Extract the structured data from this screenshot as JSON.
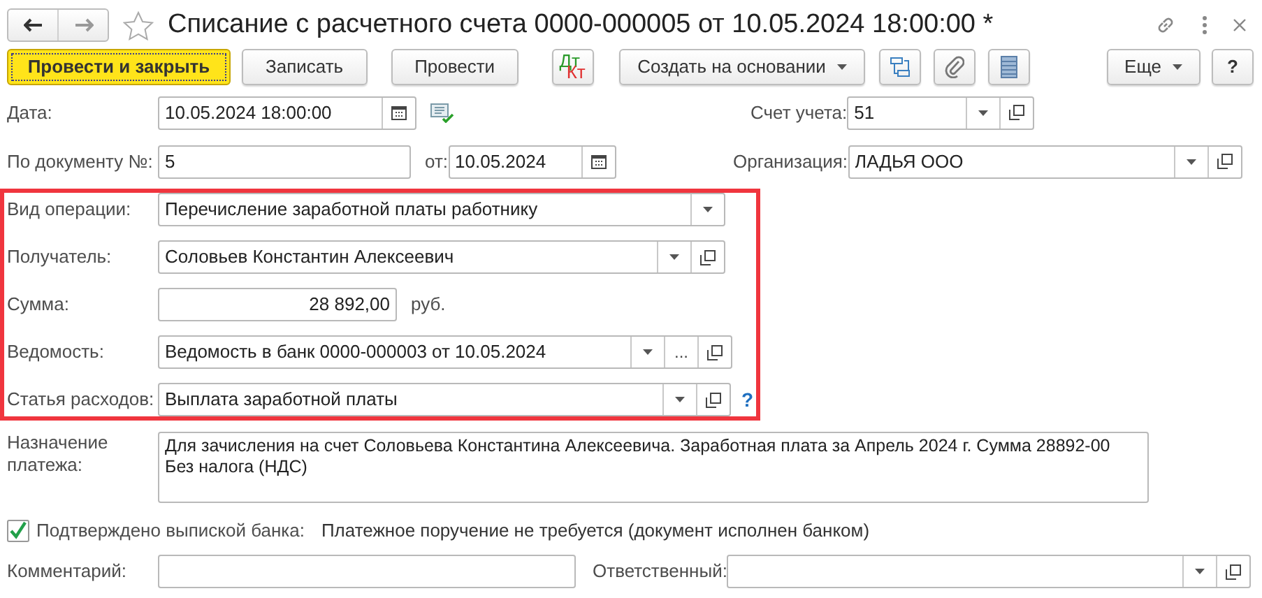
{
  "window": {
    "title": "Списание с расчетного счета 0000-000005 от 10.05.2024 18:00:00 *",
    "favorite": false
  },
  "toolbar": [
    {
      "kind": "primary",
      "label": "Провести и закрыть"
    },
    {
      "kind": "button",
      "label": "Записать"
    },
    {
      "kind": "button",
      "label": "Провести"
    },
    {
      "kind": "dtkt",
      "debit": "Дт",
      "credit": "Кт"
    },
    {
      "kind": "menu",
      "label": "Создать на основании"
    },
    {
      "kind": "structure"
    },
    {
      "kind": "attach"
    },
    {
      "kind": "list"
    },
    {
      "kind": "menu",
      "label": "Еще"
    },
    {
      "kind": "help",
      "label": "?"
    }
  ],
  "header": {
    "date": {
      "label": "Дата:",
      "value": "10.05.2024 18:00:00"
    },
    "account": {
      "label": "Счет учета:",
      "value": "51",
      "dropdown": true,
      "open_button": true
    },
    "doc_number": {
      "label": "По документу №:",
      "value": "5"
    },
    "doc_date": {
      "label": "от:",
      "value": "10.05.2024"
    },
    "organization": {
      "label": "Организация:",
      "value": "ЛАДЬЯ ООО",
      "dropdown": true,
      "open_button": true
    }
  },
  "highlighted_fields": [
    {
      "kind": "select",
      "label": "Вид операции:",
      "value": "Перечисление заработной платы работнику",
      "dropdown": true
    },
    {
      "kind": "select",
      "label": "Получатель:",
      "value": "Соловьев Константин Алексеевич",
      "dropdown": true,
      "open_button": true
    },
    {
      "kind": "amount",
      "label": "Сумма:",
      "value": "28 892,00",
      "unit": "руб."
    },
    {
      "kind": "select",
      "label": "Ведомость:",
      "value": "Ведомость в банк 0000-000003 от 10.05.2024",
      "dropdown": true,
      "select_button": "...",
      "open_button": true
    },
    {
      "kind": "select",
      "label": "Статья расходов:",
      "value": "Выплата заработной платы",
      "dropdown": true,
      "open_button": true,
      "help": "?"
    }
  ],
  "purpose": {
    "label": "Назначение платежа:",
    "value": "Для зачисления на счет Соловьева Константина Алексеевича. Заработная плата за Апрель 2024 г. Сумма 28892-00\nБез налога (НДС)"
  },
  "confirmed": {
    "label": "Подтверждено выпиской банка:",
    "checked": true,
    "note": "Платежное поручение не требуется (документ исполнен банком)"
  },
  "comment": {
    "label": "Комментарий:"
  },
  "responsible": {
    "label": "Ответственный:",
    "dropdown": true,
    "open_button": true
  }
}
